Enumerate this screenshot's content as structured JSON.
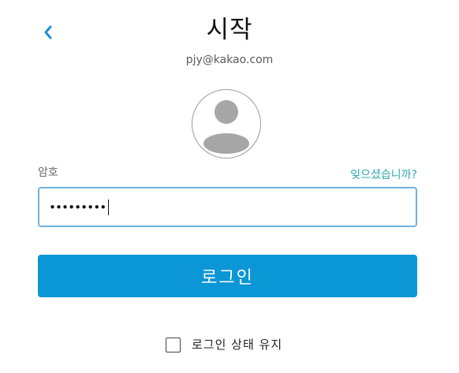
{
  "header": {
    "back_icon": "chevron-left-icon",
    "title": "시작",
    "email": "pjy@kakao.com"
  },
  "avatar": {
    "icon": "user-avatar-icon"
  },
  "password": {
    "label": "암호",
    "forgot_link": "잊으셨습니까?",
    "masked_value": "•••••••••"
  },
  "login_button": {
    "label": "로그인"
  },
  "keep_signed_in": {
    "label": "로그인 상태 유지",
    "checked": false
  },
  "colors": {
    "accent": "#0b96d6",
    "link": "#2ba8b0",
    "input_border": "#6fb2de",
    "avatar_gray": "#a6a6a6"
  }
}
